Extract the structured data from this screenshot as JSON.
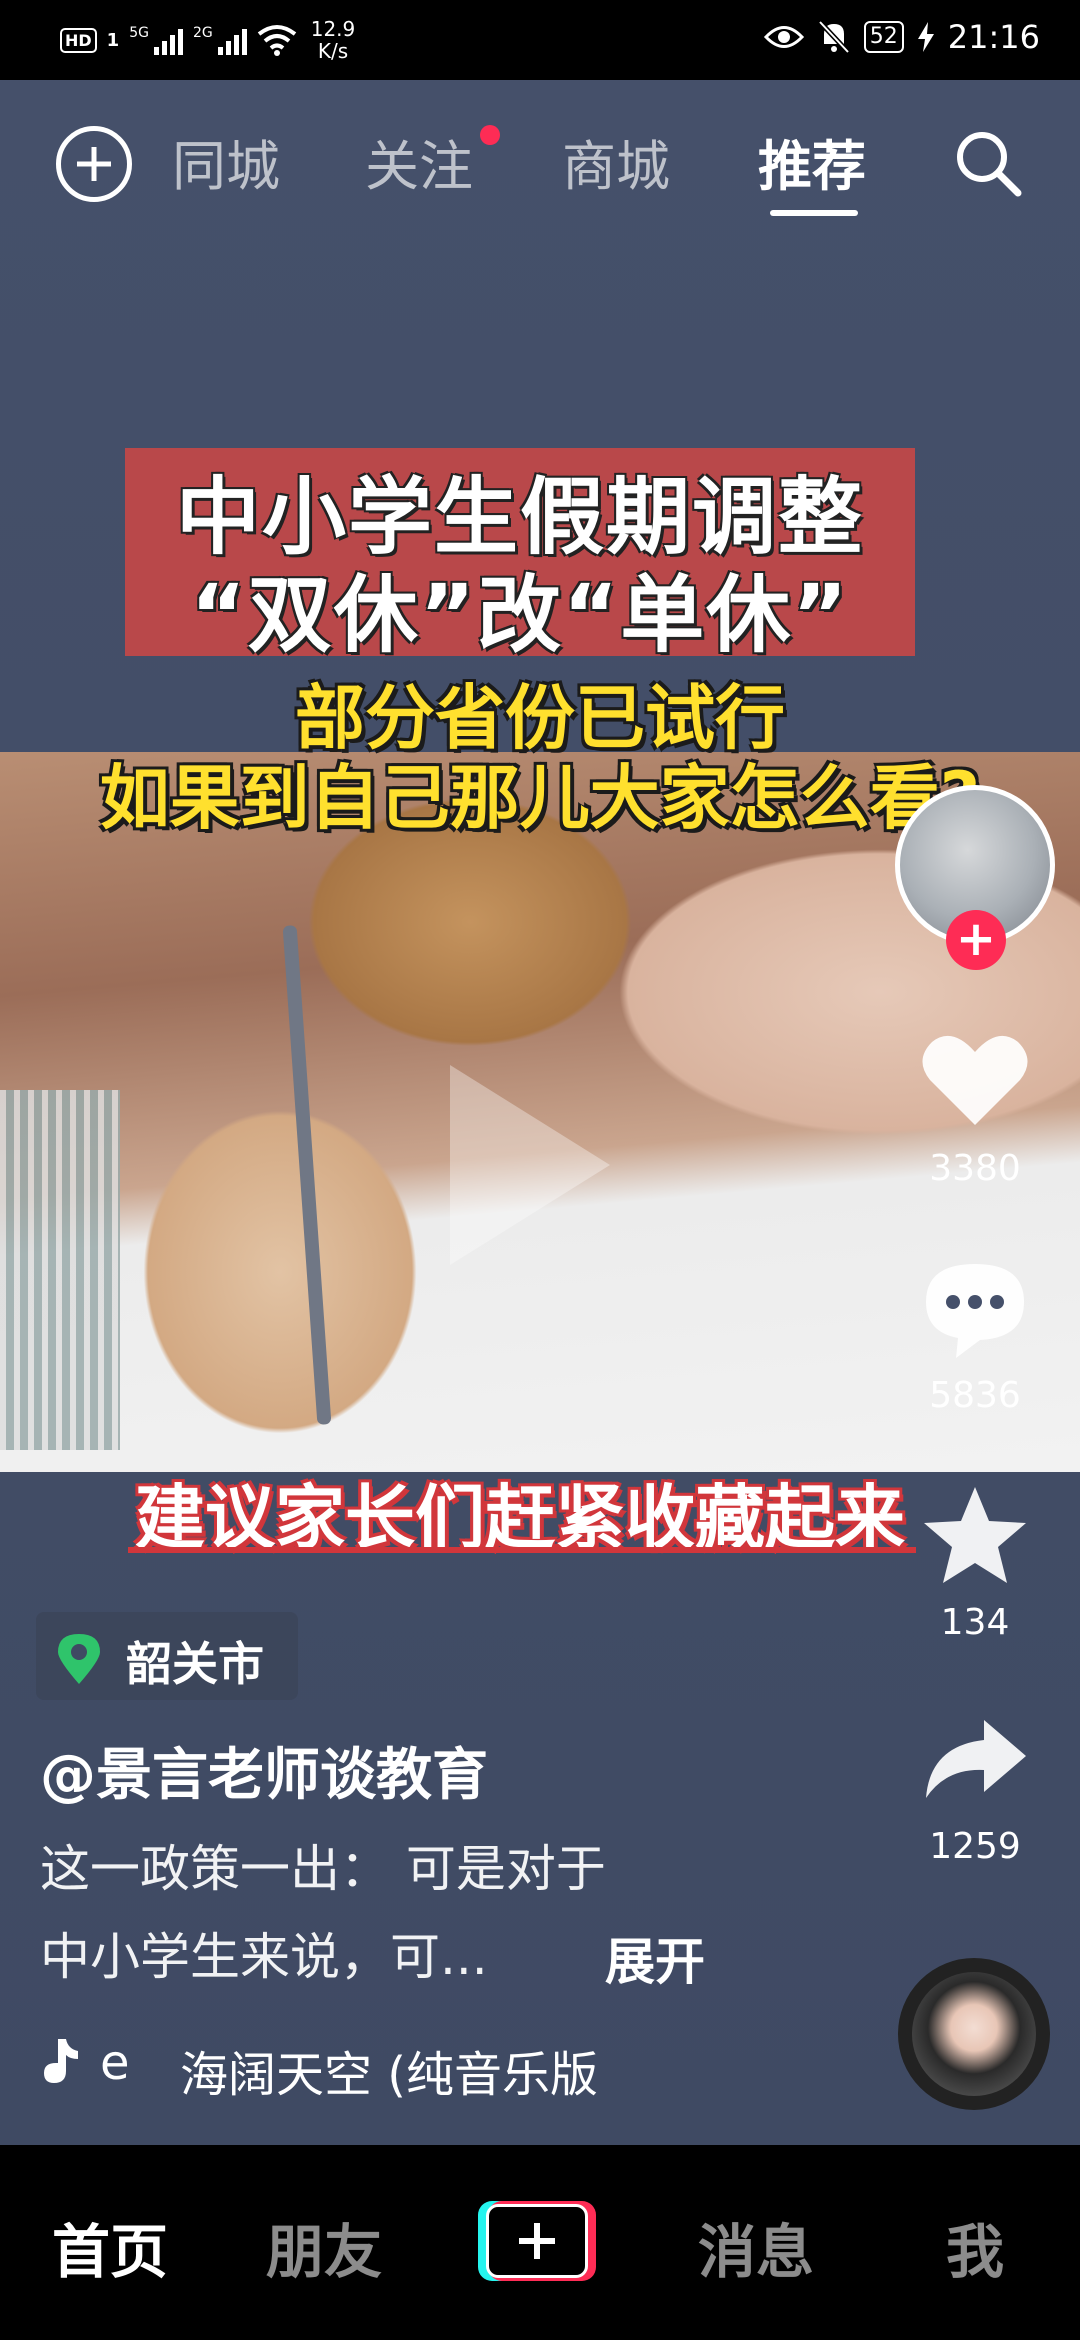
{
  "status_bar": {
    "hd": "HD",
    "sim": "1",
    "net1": "5G",
    "net2": "2G",
    "speed_value": "12.9",
    "speed_unit": "K/s",
    "battery": "52",
    "time": "21:16"
  },
  "top_nav": {
    "tabs": [
      {
        "label": "同城"
      },
      {
        "label": "关注"
      },
      {
        "label": "商城"
      },
      {
        "label": "推荐"
      }
    ],
    "active_tab": "推荐"
  },
  "video": {
    "title_line1": "中小学生假期调整",
    "title_line2": "“双休”改“单休”",
    "subtitle_line1": "部分省份已试行",
    "subtitle_line2": "如果到自己那儿大家怎么看?",
    "bottom_caption": "建议家长们赶紧收藏起来"
  },
  "actions": {
    "follow_plus": "+",
    "likes": "3380",
    "comments": "5836",
    "favorites": "134",
    "shares": "1259"
  },
  "info": {
    "location": "韶关市",
    "username": "@景言老师谈教育",
    "desc_line1": "这一政策一出：  可是对于",
    "desc_line2": "中小学生来说，可...",
    "expand": "展开",
    "music_prefix": "e",
    "music": "海阔天空 (纯音乐版"
  },
  "bottom_nav": {
    "items": [
      {
        "label": "首页"
      },
      {
        "label": "朋友"
      },
      {
        "label": "消息"
      },
      {
        "label": "我"
      }
    ]
  }
}
